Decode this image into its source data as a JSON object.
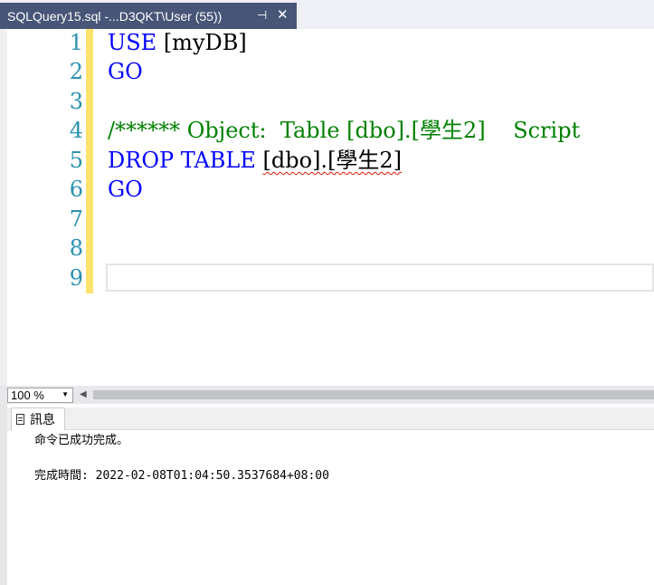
{
  "tab": {
    "title": "SQLQuery15.sql -...D3QKT\\User (55))",
    "pin_glyph": "⊣",
    "close_glyph": "✕"
  },
  "editor": {
    "line_numbers": [
      "1",
      "2",
      "3",
      "4",
      "5",
      "6",
      "7",
      "8",
      "9"
    ],
    "lines": {
      "l1_kw": "USE",
      "l1_rest": " [myDB]",
      "l2_kw": "GO",
      "l4_comment": "/****** Object:  Table [dbo].[學生2]    Script",
      "l5_kw": "DROP TABLE",
      "l5_rest": " ",
      "l5_obj": "[dbo].[學生2]",
      "l6_kw": "GO"
    }
  },
  "zoom": {
    "value": "100 %"
  },
  "results": {
    "tab_label": "訊息",
    "message_1": "命令已成功完成。",
    "message_2": "完成時間: 2022-02-08T01:04:50.3537684+08:00"
  }
}
